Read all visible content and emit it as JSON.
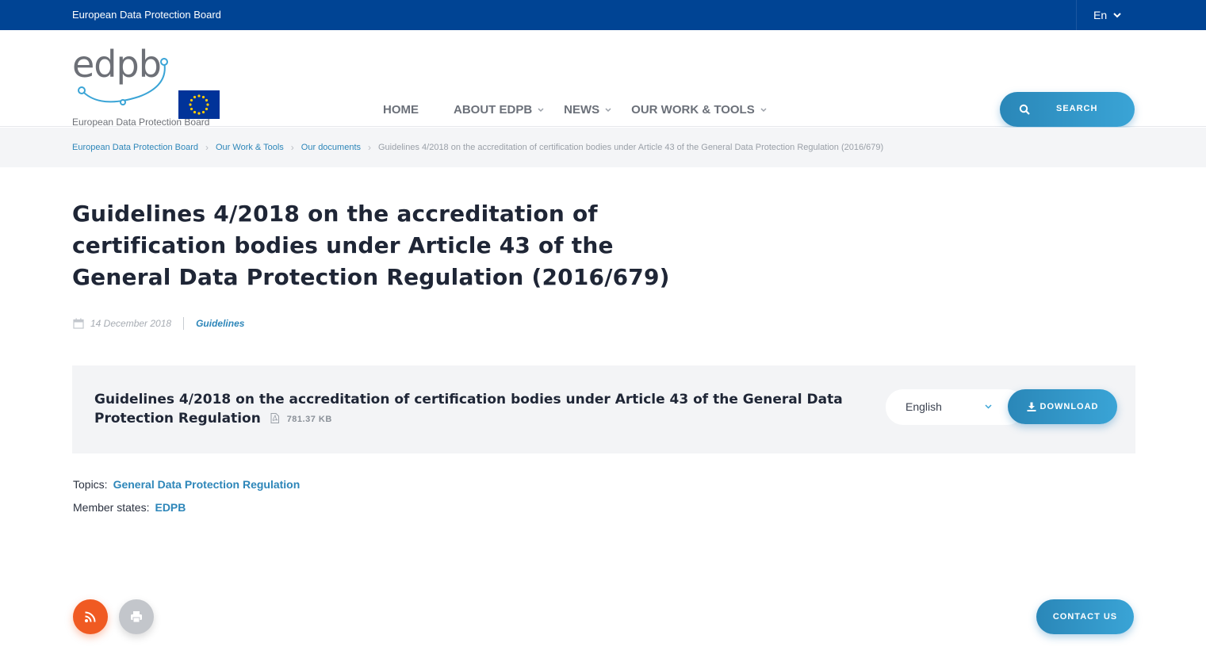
{
  "topbar": {
    "title": "European Data Protection Board",
    "language": "En"
  },
  "header": {
    "logo_word": "edpb",
    "logo_sub": "European Data Protection Board",
    "nav": [
      {
        "label": "HOME",
        "has_dropdown": false
      },
      {
        "label": "ABOUT EDPB",
        "has_dropdown": true
      },
      {
        "label": "NEWS",
        "has_dropdown": true
      },
      {
        "label": "OUR WORK & TOOLS",
        "has_dropdown": true
      }
    ],
    "search_label": "SEARCH"
  },
  "breadcrumb": {
    "items": [
      "European Data Protection Board",
      "Our Work & Tools",
      "Our documents"
    ],
    "current": "Guidelines 4/2018 on the accreditation of certification bodies under Article 43 of the General Data Protection Regulation (2016/679)"
  },
  "page": {
    "title": "Guidelines 4/2018 on the accreditation of certification bodies under Article 43 of the General Data Protection Regulation (2016/679)",
    "date": "14 December 2018",
    "category": "Guidelines"
  },
  "document": {
    "title": "Guidelines 4/2018 on the accreditation of certification bodies under Article 43 of the General Data Protection Regulation",
    "size": "781.37 KB",
    "language": "English",
    "download_label": "DOWNLOAD"
  },
  "topics": {
    "topics_label": "Topics:",
    "topics_value": "General Data Protection Regulation",
    "member_label": "Member states:",
    "member_value": "EDPB"
  },
  "footer": {
    "contact_label": "CONTACT US"
  },
  "colors": {
    "topbar": "#004494",
    "accent": "#2d86b9",
    "rss": "#f05a22"
  }
}
